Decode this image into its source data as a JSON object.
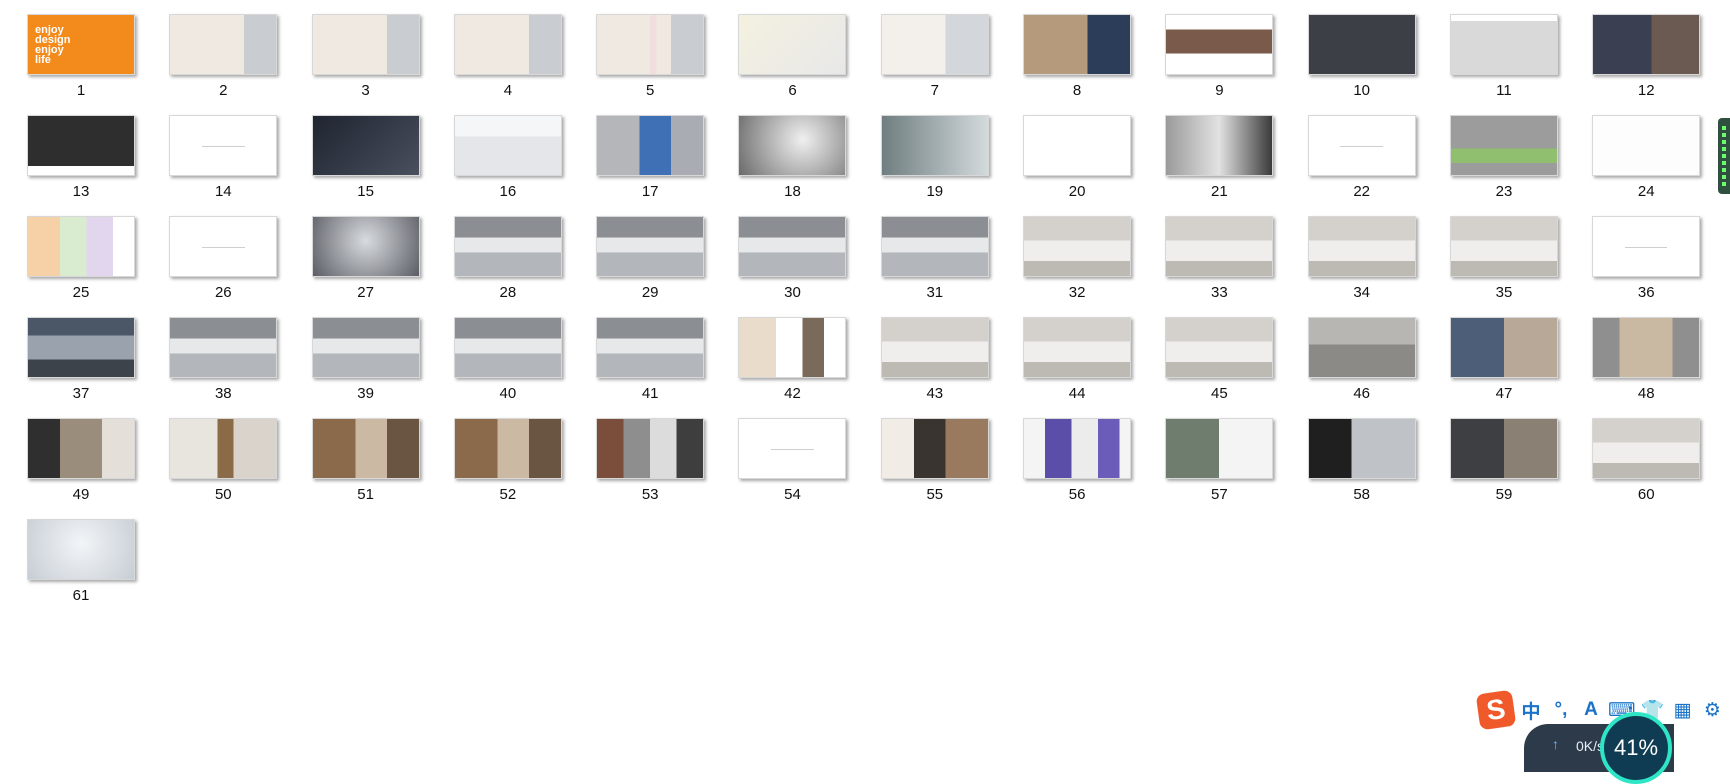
{
  "slide_sorter": {
    "slides": [
      {
        "number": "1",
        "style": "orange",
        "title_text": "enjoy\ndesign\nenjoy\nlife"
      },
      {
        "number": "2",
        "style": "beige"
      },
      {
        "number": "3",
        "style": "beige"
      },
      {
        "number": "4",
        "style": "beige"
      },
      {
        "number": "5",
        "style": "beige-red"
      },
      {
        "number": "6",
        "style": "floorplan-yellow"
      },
      {
        "number": "7",
        "style": "table"
      },
      {
        "number": "8",
        "style": "reception"
      },
      {
        "number": "9",
        "style": "skyline"
      },
      {
        "number": "10",
        "style": "dark-map"
      },
      {
        "number": "11",
        "style": "bar-chart"
      },
      {
        "number": "12",
        "style": "portrait"
      },
      {
        "number": "13",
        "style": "dark-chart"
      },
      {
        "number": "14",
        "style": "blank"
      },
      {
        "number": "15",
        "style": "dark-photo"
      },
      {
        "number": "16",
        "style": "car-white"
      },
      {
        "number": "17",
        "style": "car-blue"
      },
      {
        "number": "18",
        "style": "gray-gradient"
      },
      {
        "number": "19",
        "style": "gray-teal"
      },
      {
        "number": "20",
        "style": "diagram"
      },
      {
        "number": "21",
        "style": "gray-texture"
      },
      {
        "number": "22",
        "style": "blank"
      },
      {
        "number": "23",
        "style": "site-plan"
      },
      {
        "number": "24",
        "style": "floorplan-red"
      },
      {
        "number": "25",
        "style": "floorplan-color"
      },
      {
        "number": "26",
        "style": "blank"
      },
      {
        "number": "27",
        "style": "crystal"
      },
      {
        "number": "28",
        "style": "hall"
      },
      {
        "number": "29",
        "style": "hall"
      },
      {
        "number": "30",
        "style": "hall"
      },
      {
        "number": "31",
        "style": "hall"
      },
      {
        "number": "32",
        "style": "interior-light"
      },
      {
        "number": "33",
        "style": "interior-light"
      },
      {
        "number": "34",
        "style": "interior-light"
      },
      {
        "number": "35",
        "style": "interior-light"
      },
      {
        "number": "36",
        "style": "blank"
      },
      {
        "number": "37",
        "style": "hall-dark"
      },
      {
        "number": "38",
        "style": "hall"
      },
      {
        "number": "39",
        "style": "hall"
      },
      {
        "number": "40",
        "style": "hall"
      },
      {
        "number": "41",
        "style": "hall"
      },
      {
        "number": "42",
        "style": "collage"
      },
      {
        "number": "43",
        "style": "interior-light"
      },
      {
        "number": "44",
        "style": "interior-light"
      },
      {
        "number": "45",
        "style": "interior-light"
      },
      {
        "number": "46",
        "style": "meeting"
      },
      {
        "number": "47",
        "style": "lounge"
      },
      {
        "number": "48",
        "style": "wood-door"
      },
      {
        "number": "49",
        "style": "corridor"
      },
      {
        "number": "50",
        "style": "wood-light"
      },
      {
        "number": "51",
        "style": "wood-warm"
      },
      {
        "number": "52",
        "style": "wood-warm"
      },
      {
        "number": "53",
        "style": "materials"
      },
      {
        "number": "54",
        "style": "blank"
      },
      {
        "number": "55",
        "style": "art-brown"
      },
      {
        "number": "56",
        "style": "art-purple"
      },
      {
        "number": "57",
        "style": "interior-logo"
      },
      {
        "number": "58",
        "style": "dark-interior"
      },
      {
        "number": "59",
        "style": "lounge-dark"
      },
      {
        "number": "60",
        "style": "interior-light"
      },
      {
        "number": "61",
        "style": "sculpture"
      }
    ]
  },
  "ime_toolbar": {
    "logo": "S",
    "items": [
      {
        "label": "中",
        "icon": "chinese-mode-icon"
      },
      {
        "label": "°,",
        "icon": "punctuation-icon"
      },
      {
        "label": "A",
        "icon": "ai-assistant-icon"
      },
      {
        "label": "⌨",
        "icon": "keyboard-icon"
      },
      {
        "label": "👕",
        "icon": "skin-icon"
      },
      {
        "label": "▦",
        "icon": "toolbox-icon"
      },
      {
        "label": "⚙",
        "icon": "settings-icon"
      }
    ]
  },
  "net_monitor": {
    "arrow": "↑",
    "speed": "0K/s",
    "percent": "41%"
  }
}
